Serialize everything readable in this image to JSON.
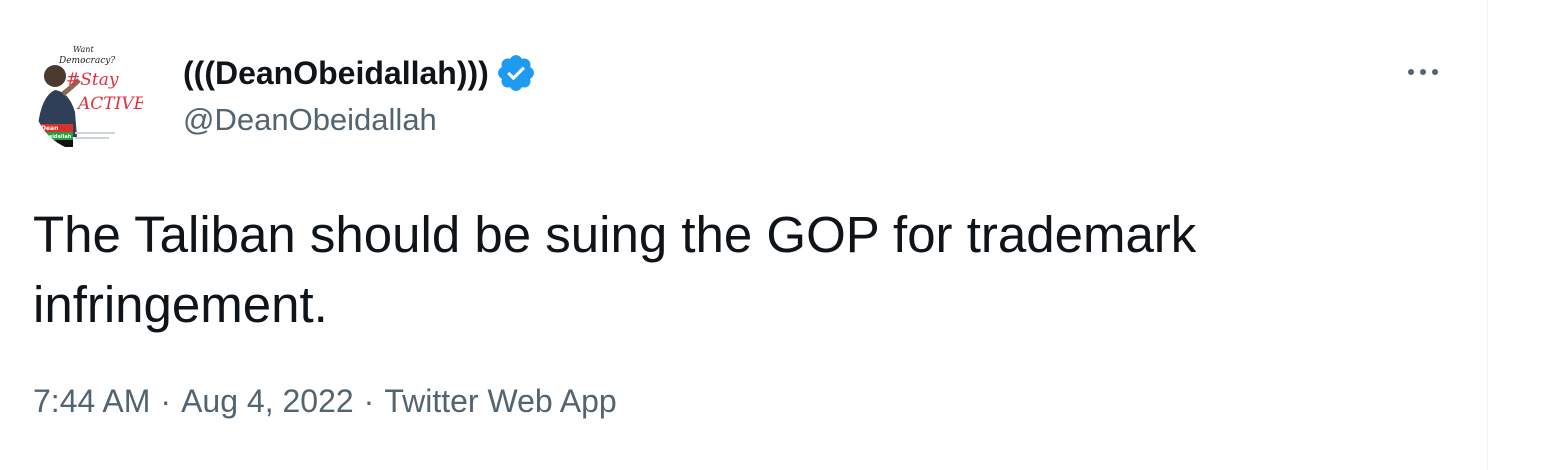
{
  "tweet": {
    "avatar": {
      "lines": [
        "Want",
        "Democracy?",
        "#Stay",
        "ACTIVE!",
        "Dean",
        "Obeidallah"
      ]
    },
    "display_name": "(((DeanObeidallah)))",
    "verified_icon": "verified-badge",
    "handle": "@DeanObeidallah",
    "more_icon": "more-horizontal-icon",
    "text": "The Taliban should be suing the GOP for trademark\ninfringement.",
    "time": "7:44 AM",
    "separator": "·",
    "date": "Aug 4, 2022",
    "source": "Twitter Web App",
    "colors": {
      "text_primary": "#0f1419",
      "text_secondary": "#536471",
      "verified_blue": "#1d9bf0",
      "divider": "#eff3f4"
    }
  }
}
